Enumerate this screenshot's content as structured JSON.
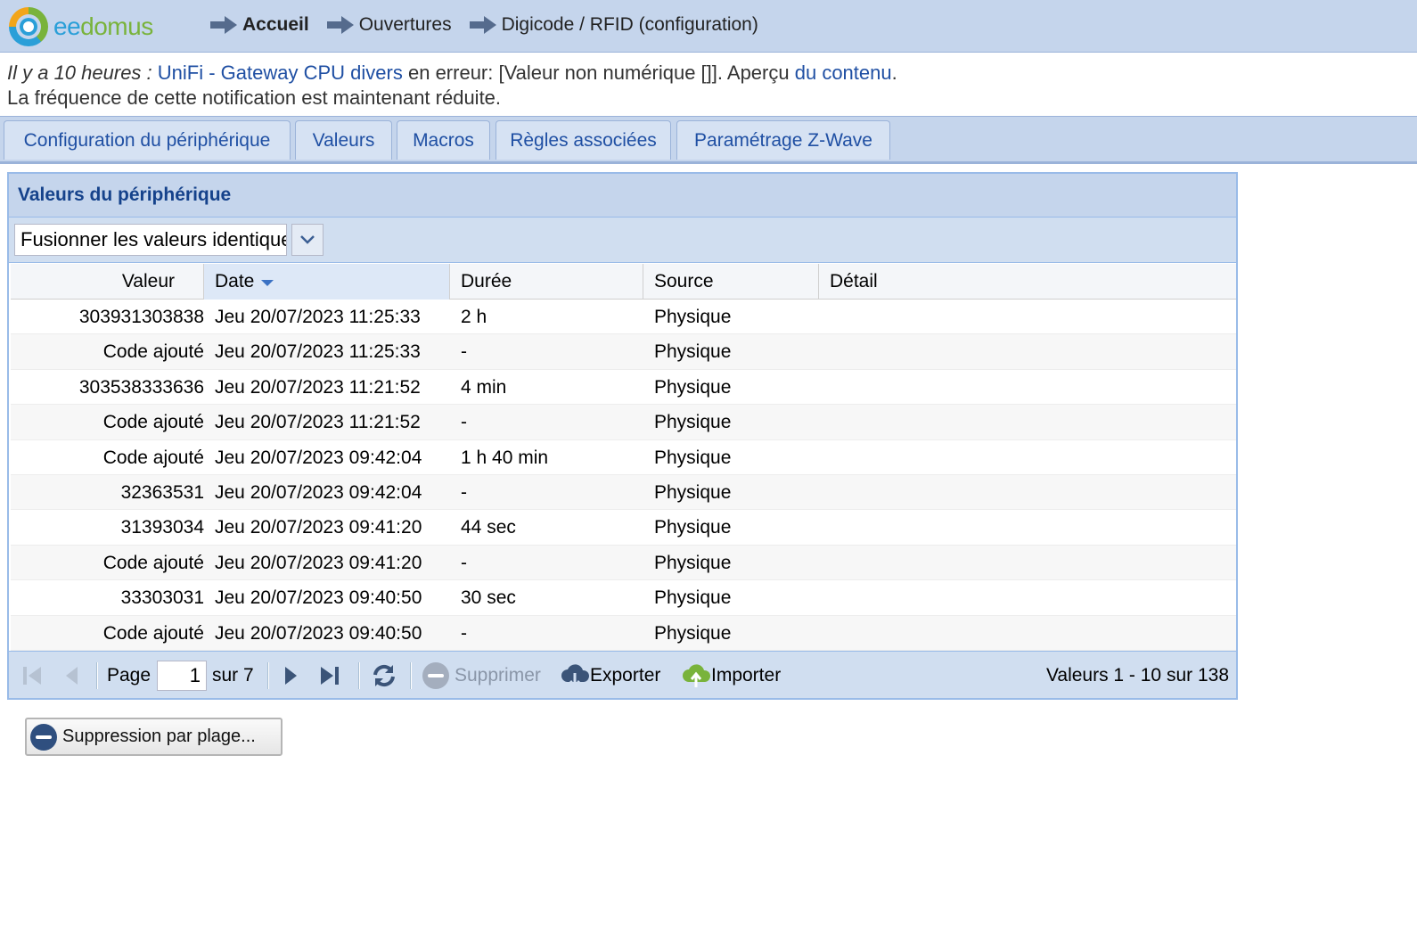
{
  "app": {
    "logo_part1": "ee",
    "logo_part2": "domus"
  },
  "breadcrumb": [
    {
      "label": "Accueil"
    },
    {
      "label": "Ouvertures"
    },
    {
      "label": "Digicode / RFID (configuration)"
    }
  ],
  "notification": {
    "time_text": "Il y a 10 heures :",
    "device_link": "UniFi - Gateway CPU divers",
    "message": "en erreur: [Valeur non numérique []]. Aperçu",
    "content_link": "du contenu",
    "period": ".",
    "line2": "La fréquence de cette notification est maintenant réduite."
  },
  "tabs": [
    {
      "label": "Configuration du périphérique"
    },
    {
      "label": "Valeurs"
    },
    {
      "label": "Macros"
    },
    {
      "label": "Règles associées"
    },
    {
      "label": "Paramétrage Z-Wave"
    }
  ],
  "panel": {
    "title": "Valeurs du périphérique",
    "merge_combo_value": "Fusionner les valeurs identiques"
  },
  "grid": {
    "columns": [
      "Valeur",
      "Date",
      "Durée",
      "Source",
      "Détail"
    ],
    "sorted_column": "Date",
    "rows": [
      {
        "valeur": "303931303838",
        "date": "Jeu 20/07/2023 11:25:33",
        "duree": "2 h",
        "source": "Physique",
        "detail": ""
      },
      {
        "valeur": "Code ajouté",
        "date": "Jeu 20/07/2023 11:25:33",
        "duree": "-",
        "source": "Physique",
        "detail": ""
      },
      {
        "valeur": "303538333636",
        "date": "Jeu 20/07/2023 11:21:52",
        "duree": "4 min",
        "source": "Physique",
        "detail": ""
      },
      {
        "valeur": "Code ajouté",
        "date": "Jeu 20/07/2023 11:21:52",
        "duree": "-",
        "source": "Physique",
        "detail": ""
      },
      {
        "valeur": "Code ajouté",
        "date": "Jeu 20/07/2023 09:42:04",
        "duree": "1 h 40 min",
        "source": "Physique",
        "detail": ""
      },
      {
        "valeur": "32363531",
        "date": "Jeu 20/07/2023 09:42:04",
        "duree": "-",
        "source": "Physique",
        "detail": ""
      },
      {
        "valeur": "31393034",
        "date": "Jeu 20/07/2023 09:41:20",
        "duree": "44 sec",
        "source": "Physique",
        "detail": ""
      },
      {
        "valeur": "Code ajouté",
        "date": "Jeu 20/07/2023 09:41:20",
        "duree": "-",
        "source": "Physique",
        "detail": ""
      },
      {
        "valeur": "33303031",
        "date": "Jeu 20/07/2023 09:40:50",
        "duree": "30 sec",
        "source": "Physique",
        "detail": ""
      },
      {
        "valeur": "Code ajouté",
        "date": "Jeu 20/07/2023 09:40:50",
        "duree": "-",
        "source": "Physique",
        "detail": ""
      }
    ]
  },
  "pager": {
    "page_label": "Page",
    "page_value": "1",
    "of_label": "sur 7",
    "delete_label": "Supprimer",
    "export_label": "Exporter",
    "import_label": "Importer",
    "summary": "Valeurs 1 - 10 sur 138"
  },
  "range_delete_label": "Suppression par plage...",
  "colors": {
    "header_bg": "#c5d5ec",
    "link": "#1f4fa3",
    "panel_title": "#15428b",
    "import_green": "#79b33b"
  }
}
